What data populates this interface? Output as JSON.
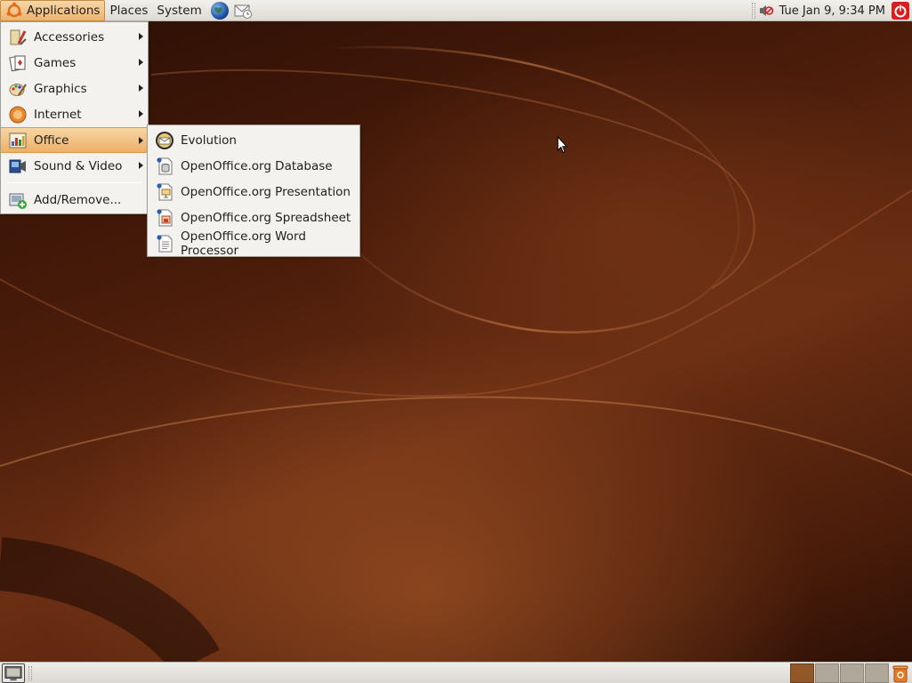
{
  "top_panel": {
    "applications_label": "Applications",
    "places_label": "Places",
    "system_label": "System",
    "launchers": [
      "web-browser-icon",
      "mail-client-icon"
    ],
    "clock": "Tue Jan  9,  9:34 PM"
  },
  "applications_menu": {
    "items": [
      {
        "label": "Accessories",
        "icon": "accessories-icon"
      },
      {
        "label": "Games",
        "icon": "games-icon"
      },
      {
        "label": "Graphics",
        "icon": "graphics-icon"
      },
      {
        "label": "Internet",
        "icon": "internet-icon"
      },
      {
        "label": "Office",
        "icon": "office-icon"
      },
      {
        "label": "Sound & Video",
        "icon": "sound-video-icon"
      }
    ],
    "add_remove_label": "Add/Remove..."
  },
  "office_submenu": {
    "items": [
      {
        "label": "Evolution",
        "icon": "evolution-icon"
      },
      {
        "label": "OpenOffice.org Database",
        "icon": "database-icon"
      },
      {
        "label": "OpenOffice.org Presentation",
        "icon": "presentation-icon"
      },
      {
        "label": "OpenOffice.org Spreadsheet",
        "icon": "spreadsheet-icon"
      },
      {
        "label": "OpenOffice.org Word Processor",
        "icon": "word-processor-icon"
      }
    ]
  },
  "bottom_panel": {
    "workspaces": 4,
    "active_workspace": 1
  },
  "colors": {
    "menu_highlight": "#eeb068",
    "panel": "#e6e3de",
    "desktop": "#4a1c0a",
    "active_workspace": "#92582a"
  }
}
